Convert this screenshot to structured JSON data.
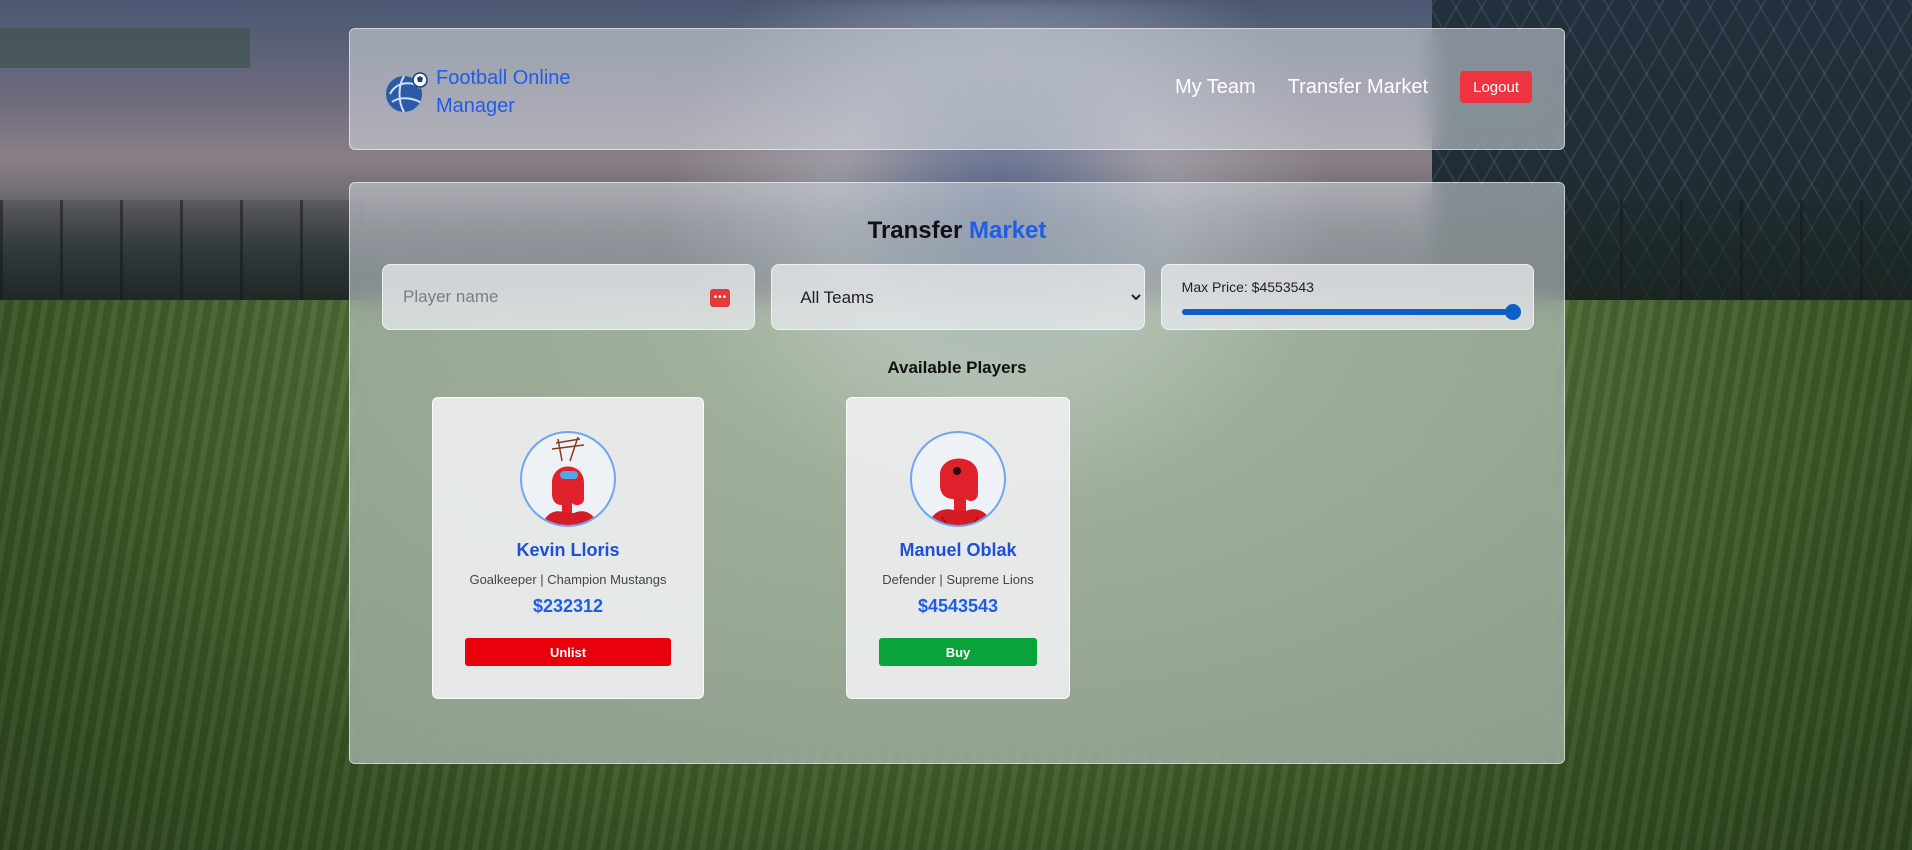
{
  "brand": {
    "title": "Football Online Manager",
    "logo_icon": "globe-football-icon"
  },
  "nav": {
    "links": [
      {
        "label": "My Team"
      },
      {
        "label": "Transfer Market"
      }
    ],
    "logout_label": "Logout"
  },
  "market": {
    "title_main": "Transfer",
    "title_accent": "Market",
    "search_placeholder": "Player name",
    "team_filter": {
      "selected": "All Teams",
      "options": [
        "All Teams"
      ]
    },
    "price": {
      "label": "Max Price: $4553543",
      "slider_fraction": 1.0
    },
    "section_title": "Available Players",
    "players": [
      {
        "name": "Kevin Lloris",
        "meta": "Goalkeeper | Champion Mustangs",
        "price": "$232312",
        "action": "Unlist",
        "action_color": "#e8000b"
      },
      {
        "name": "Manuel Oblak",
        "meta": "Defender | Supreme Lions",
        "price": "$4543543",
        "action": "Buy",
        "action_color": "#0aa23b"
      }
    ]
  },
  "colors": {
    "accent": "#1e5ee6",
    "logout": "#ef3340",
    "unlist": "#e8000b",
    "buy": "#0aa23b",
    "slider": "#0b5fc6"
  }
}
